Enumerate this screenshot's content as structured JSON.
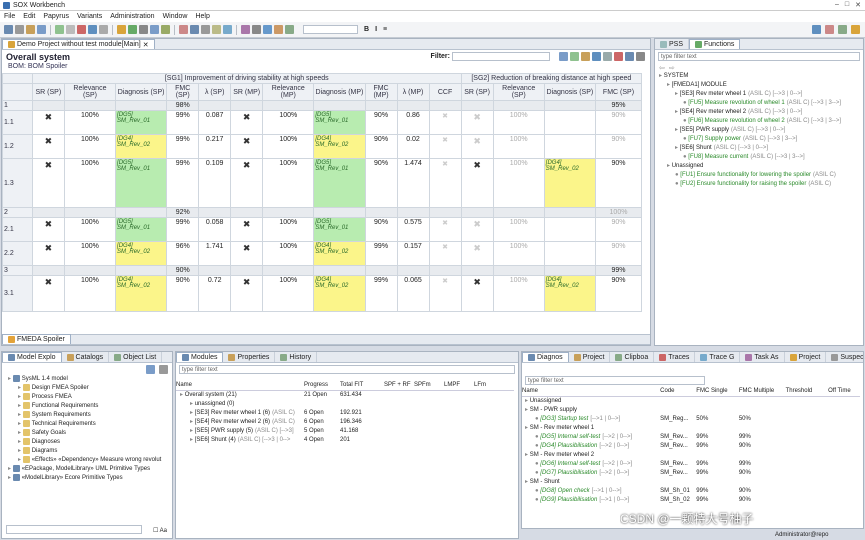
{
  "app": {
    "title": "SOX Workbench"
  },
  "menu": [
    "File",
    "Edit",
    "Papyrus",
    "Variants",
    "Administration",
    "Window",
    "Help"
  ],
  "editor": {
    "tab": "Demo Project without test module[Main]",
    "title": "Overall system",
    "bom": "BOM: BOM Spoiler",
    "filter_label": "Filter:",
    "sg1": "[SG1] Improvement of driving stability at high speeds",
    "sg2": "[SG2] Reduction of breaking distance at high speed",
    "cols": [
      "SR (SP)",
      "Relevance (SP)",
      "Diagnosis (SP)",
      "FMC (SP)",
      "λ (SP)",
      "SR (MP)",
      "Relevance (MP)",
      "Diagnosis (MP)",
      "FMC (MP)",
      "λ (MP)",
      "CCF",
      "SR (SP)",
      "Relevance (SP)",
      "Diagnosis (SP)",
      "FMC (SP)"
    ],
    "rows": [
      {
        "id": "1",
        "fmc": "98%",
        "fmc2": "95%"
      },
      {
        "id": "1.1",
        "rel": "100%",
        "d1": "[DG5]",
        "d2": "SM_Rev_01",
        "fmc": "99%",
        "lam": "0.087",
        "relm": "100%",
        "dm1": "[DG5]",
        "dm2": "SM_Rev_01",
        "fmcm": "90%",
        "lamm": "0.86",
        "rel2": "100%",
        "fmc2": "90%"
      },
      {
        "id": "1.2",
        "rel": "100%",
        "d1": "[DG4]",
        "d2": "SM_Rev_02",
        "fmc": "99%",
        "lam": "0.217",
        "relm": "100%",
        "dm1": "[DG4]",
        "dm2": "SM_Rev_02",
        "fmcm": "90%",
        "lamm": "0.02",
        "rel2": "100%",
        "fmc2": "90%"
      },
      {
        "id": "1.3",
        "rel": "100%",
        "d1": "[DG5]",
        "d2": "SM_Rev_01",
        "fmc": "99%",
        "lam": "0.109",
        "relm": "100%",
        "dm1": "[DG5]",
        "dm2": "SM_Rev_01",
        "fmcm": "90%",
        "lamm": "1.474",
        "rel2": "100%",
        "d21": "[DG4]",
        "d22": "SM_Rev_02",
        "fmc2": "90%"
      },
      {
        "id": "2",
        "fmc": "92%",
        "fmc2": "100%"
      },
      {
        "id": "2.1",
        "rel": "100%",
        "d1": "[DG5]",
        "d2": "SM_Rev_01",
        "fmc": "99%",
        "lam": "0.058",
        "relm": "100%",
        "dm1": "[DG5]",
        "dm2": "SM_Rev_01",
        "fmcm": "90%",
        "lamm": "0.575",
        "rel2": "100%",
        "fmc2": "90%"
      },
      {
        "id": "2.2",
        "rel": "100%",
        "d1": "[DG4]",
        "d2": "SM_Rev_02",
        "fmc": "96%",
        "lam": "1.741",
        "relm": "100%",
        "dm1": "[DG4]",
        "dm2": "SM_Rev_02",
        "fmcm": "99%",
        "lamm": "0.157",
        "rel2": "100%",
        "fmc2": "90%"
      },
      {
        "id": "3",
        "fmc": "90%",
        "fmc2": "99%"
      },
      {
        "id": "3.1",
        "rel": "100%",
        "d1": "[DG4]",
        "d2": "SM_Rev_02",
        "fmc": "90%",
        "lam": "0.72",
        "relm": "100%",
        "dm1": "[DG4]",
        "dm2": "SM_Rev_02",
        "fmcm": "99%",
        "lamm": "0.065",
        "rel2": "100%",
        "d21": "[DG4]",
        "d22": "SM_Rev_02",
        "fmc2": "90%"
      }
    ],
    "bottom_tab": "FMEDA Spoiler"
  },
  "functions": {
    "tabs": [
      "PSS",
      "Functions"
    ],
    "filter": "type filter text",
    "items": [
      {
        "t": "SYSTEM",
        "lvl": 0
      },
      {
        "t": "[FMEDA1] MODULE",
        "lvl": 1
      },
      {
        "t": "[SE3] Rev meter wheel 1",
        "s": "(ASIL C) [-->3 | 0-->]",
        "lvl": 2
      },
      {
        "t": "[FU5] Measure revolution of wheel 1",
        "s": "(ASIL C) [-->3 | 3-->]",
        "lvl": 3,
        "g": 1
      },
      {
        "t": "[SE4] Rev meter wheel 2",
        "s": "(ASIL C) [-->3 | 0-->]",
        "lvl": 2
      },
      {
        "t": "[FU6] Measure revolution of wheel 2",
        "s": "(ASIL C) [-->3 | 3-->]",
        "lvl": 3,
        "g": 1
      },
      {
        "t": "[SE5] PWR supply",
        "s": "(ASIL C) [-->3 | 0-->]",
        "lvl": 2
      },
      {
        "t": "[FU7] Supply power",
        "s": "(ASIL C) [-->3 | 3-->]",
        "lvl": 3,
        "g": 1
      },
      {
        "t": "[SE6] Shunt",
        "s": "(ASIL C) [-->3 | 0-->]",
        "lvl": 2
      },
      {
        "t": "[FU8] Measure current",
        "s": "(ASIL C) [-->3 | 3-->]",
        "lvl": 3,
        "g": 1
      },
      {
        "t": "Unassigned",
        "lvl": 1
      },
      {
        "t": "[FU1] Ensure functionality for lowering the spoiler",
        "s": "(ASIL C)",
        "lvl": 2,
        "g": 1
      },
      {
        "t": "[FU2] Ensure functionality for raising the spoiler",
        "s": "(ASIL C)",
        "lvl": 2,
        "g": 1
      }
    ]
  },
  "model": {
    "tabs": [
      "Model Explo",
      "Catalogs",
      "Object List"
    ],
    "items": [
      {
        "t": "SysML 1.4 model",
        "lvl": 0
      },
      {
        "t": "Design FMEA Spoiler",
        "lvl": 1
      },
      {
        "t": "Process FMEA",
        "lvl": 1
      },
      {
        "t": "Functional Requirements",
        "lvl": 1
      },
      {
        "t": "System Requirements",
        "lvl": 1
      },
      {
        "t": "Technical Requirements",
        "lvl": 1
      },
      {
        "t": "Safety Goals",
        "lvl": 1
      },
      {
        "t": "Diagnoses",
        "lvl": 1
      },
      {
        "t": "Diagrams",
        "lvl": 1
      },
      {
        "t": "«Effects» «Dependency» Measure wrong revolut",
        "lvl": 1
      },
      {
        "t": "«EPackage, ModelLibrary» UML Primitive Types",
        "lvl": 0
      },
      {
        "t": "«ModelLibrary» Ecore Primitive Types",
        "lvl": 0
      }
    ]
  },
  "modules": {
    "tabs": [
      "Modules",
      "Properties",
      "History"
    ],
    "filter": "type filter text",
    "cols": [
      "Name",
      "Progress",
      "Total FIT",
      "SPF + RF",
      "SPFm",
      "LMPF",
      "LFm"
    ],
    "rows": [
      {
        "n": "Overall system  (21)",
        "p": "21 Open",
        "f": "631.434",
        "lvl": 0
      },
      {
        "n": "unassigned  (0)",
        "p": "",
        "f": "",
        "lvl": 1
      },
      {
        "n": "[SE3] Rev meter wheel 1  (6)",
        "s": "(ASIL C)",
        "p": "6 Open",
        "f": "192.921",
        "lvl": 1
      },
      {
        "n": "[SE4] Rev meter wheel 2  (6)",
        "s": "(ASIL C)",
        "p": "6 Open",
        "f": "196.346",
        "lvl": 1
      },
      {
        "n": "[SE5] PWR supply  (5)",
        "s": "(ASIL C) [-->3]",
        "p": "5 Open",
        "f": "41.168",
        "lvl": 1
      },
      {
        "n": "[SE6] Shunt  (4)",
        "s": "(ASIL C) [-->3 | 0-->",
        "p": "4 Open",
        "f": "201",
        "lvl": 1
      }
    ]
  },
  "diagnosis": {
    "tabs": [
      "Diagnos",
      "Project",
      "Clipboa",
      "Traces",
      "Trace G",
      "Task As",
      "Project",
      "Suspect"
    ],
    "filter": "type filter text",
    "cols": [
      "Name",
      "Code",
      "FMC Single",
      "FMC Multiple",
      "Threshold",
      "Off Time"
    ],
    "rows": [
      {
        "n": "Unassigned",
        "lvl": 0
      },
      {
        "n": "SM - PWR supply",
        "lvl": 0
      },
      {
        "n": "[DG3] Startup test",
        "s": "[-->1 | 0-->]",
        "c": "SM_Reg...",
        "a": "50%",
        "b": "50%",
        "lvl": 1
      },
      {
        "n": "SM - Rev meter wheel 1",
        "lvl": 0
      },
      {
        "n": "[DG5] Internal self-test",
        "s": "[-->2 | 0-->]",
        "c": "SM_Rev...",
        "a": "99%",
        "b": "99%",
        "lvl": 1
      },
      {
        "n": "[DG4] Plausibilisation",
        "s": "[-->2 | 0-->]",
        "c": "SM_Rev...",
        "a": "99%",
        "b": "90%",
        "lvl": 1
      },
      {
        "n": "SM - Rev meter wheel 2",
        "lvl": 0
      },
      {
        "n": "[DG6] Internal self-test",
        "s": "[-->2 | 0-->]",
        "c": "SM_Rev...",
        "a": "99%",
        "b": "99%",
        "lvl": 1
      },
      {
        "n": "[DG7] Plausibilisation",
        "s": "[-->2 | 0-->]",
        "c": "SM_Rev...",
        "a": "99%",
        "b": "90%",
        "lvl": 1
      },
      {
        "n": "SM - Shunt",
        "lvl": 0
      },
      {
        "n": "[DG8] Open check",
        "s": "[-->1 | 0-->]",
        "c": "SM_Sh_01",
        "a": "99%",
        "b": "90%",
        "lvl": 1
      },
      {
        "n": "[DG9] Plausibilisation",
        "s": "[-->1 | 0-->]",
        "c": "SM_Sh_02",
        "a": "99%",
        "b": "90%",
        "lvl": 1
      }
    ]
  },
  "status": {
    "user": "Administrator@repo",
    "watermark": "CSDN @一颗特大号柚子"
  }
}
